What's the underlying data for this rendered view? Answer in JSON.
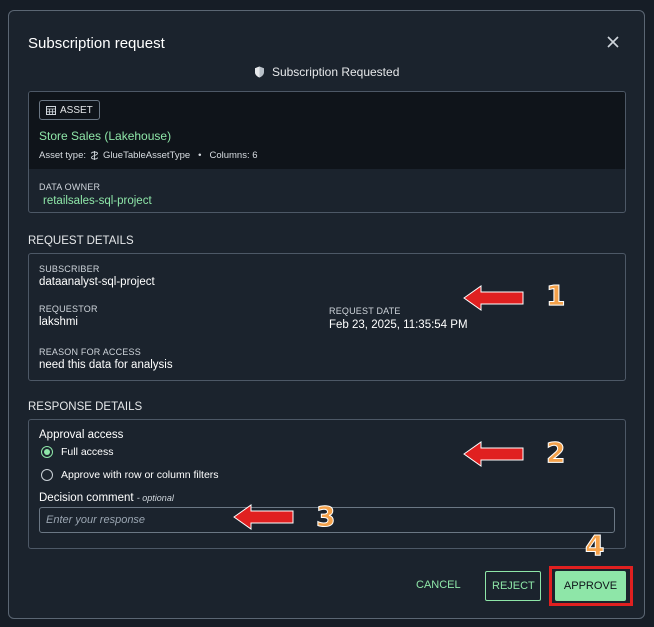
{
  "modal": {
    "title": "Subscription request",
    "status": "Subscription Requested"
  },
  "asset": {
    "badge": "ASSET",
    "name": "Store Sales (Lakehouse)",
    "type_label": "Asset type:",
    "type_value": "GlueTableAssetType",
    "dot": "•",
    "columns": "Columns: 6",
    "owner_label": "DATA OWNER",
    "owner_value": "retailsales-sql-project"
  },
  "request": {
    "heading": "REQUEST DETAILS",
    "subscriber_label": "SUBSCRIBER",
    "subscriber_value": "dataanalyst-sql-project",
    "requestor_label": "REQUESTOR",
    "requestor_value": "lakshmi",
    "date_label": "REQUEST DATE",
    "date_value": "Feb 23, 2025, 11:35:54 PM",
    "reason_label": "REASON FOR ACCESS",
    "reason_value": "need this data for analysis"
  },
  "response": {
    "heading": "RESPONSE DETAILS",
    "approval_label": "Approval access",
    "option_full": "Full access",
    "option_filters": "Approve with row or column filters",
    "selected": "Full access",
    "comment_label": "Decision comment",
    "comment_optional": "- optional",
    "comment_placeholder": "Enter your response",
    "comment_value": ""
  },
  "actions": {
    "cancel": "CANCEL",
    "reject": "REJECT",
    "approve": "APPROVE"
  },
  "annotations": {
    "n1": "1",
    "n2": "2",
    "n3": "3",
    "n4": "4"
  },
  "colors": {
    "accent": "#8ee6a8",
    "annotation_red": "#e02020",
    "annotation_number": "#f4a14a"
  }
}
